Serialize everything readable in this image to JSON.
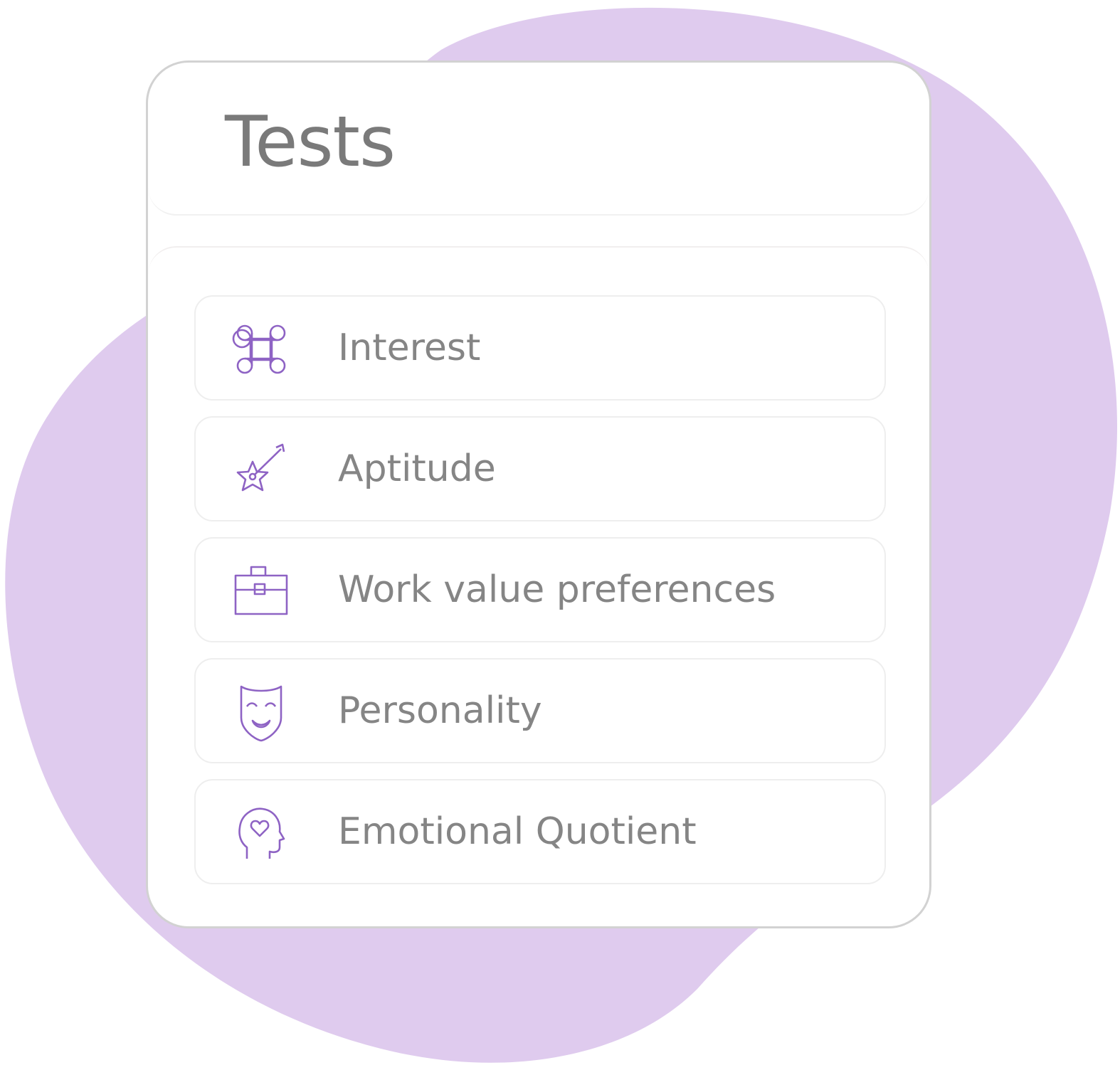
{
  "card": {
    "title": "Tests"
  },
  "tests": [
    {
      "label": "Interest",
      "icon": "command-icon"
    },
    {
      "label": "Aptitude",
      "icon": "star-target-icon"
    },
    {
      "label": "Work value preferences",
      "icon": "briefcase-icon"
    },
    {
      "label": "Personality",
      "icon": "mask-icon"
    },
    {
      "label": "Emotional Quotient",
      "icon": "head-heart-icon"
    }
  ],
  "colors": {
    "blob": "#dfcbee",
    "icon": "#8e63c4",
    "label": "#858585",
    "title": "#7a7a7a",
    "card_border": "#d2d2d2"
  }
}
